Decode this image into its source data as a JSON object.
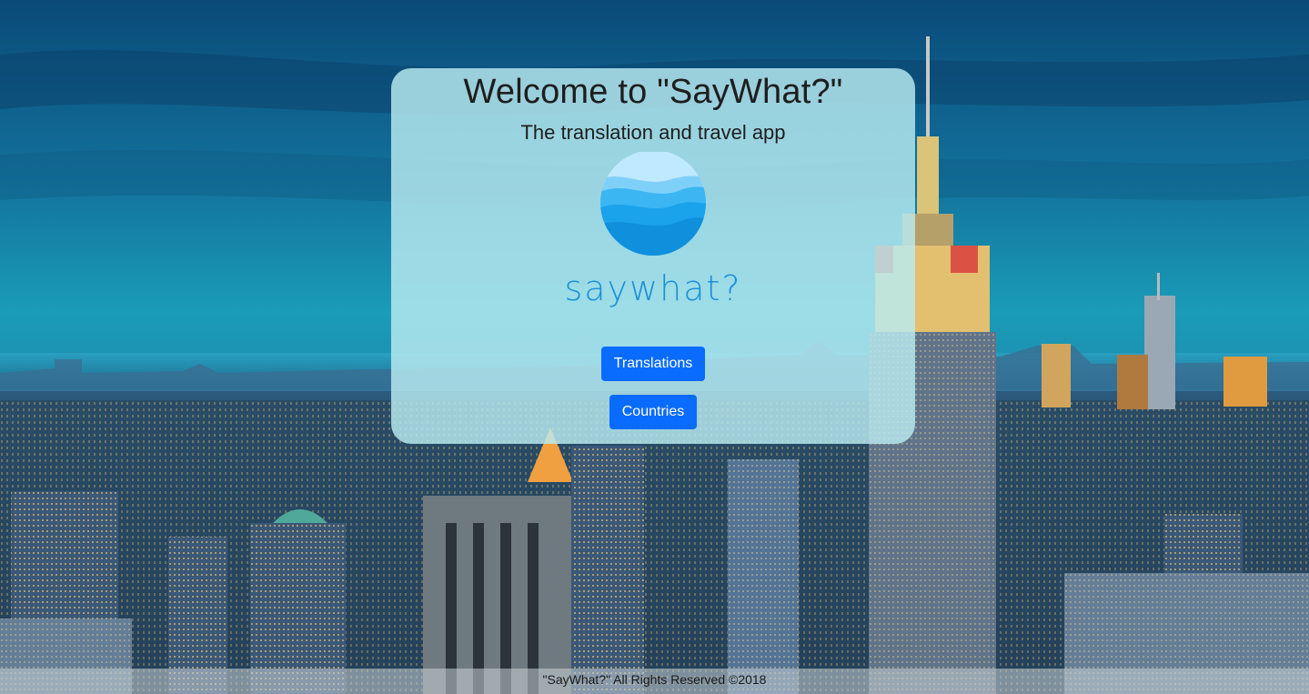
{
  "card": {
    "title": "Welcome to \"SayWhat?\"",
    "subtitle": "The translation and travel app"
  },
  "logo": {
    "icon": "saywhat-globe-logo-icon",
    "wordmark": "saywhat?",
    "color": "#1d8fd6"
  },
  "buttons": {
    "translations_label": "Translations",
    "countries_label": "Countries",
    "color": "#0a6cff"
  },
  "footer": {
    "text": "\"SayWhat?\" All Rights Reserved ©2018"
  },
  "background": {
    "icon": "city-skyline-photo"
  }
}
